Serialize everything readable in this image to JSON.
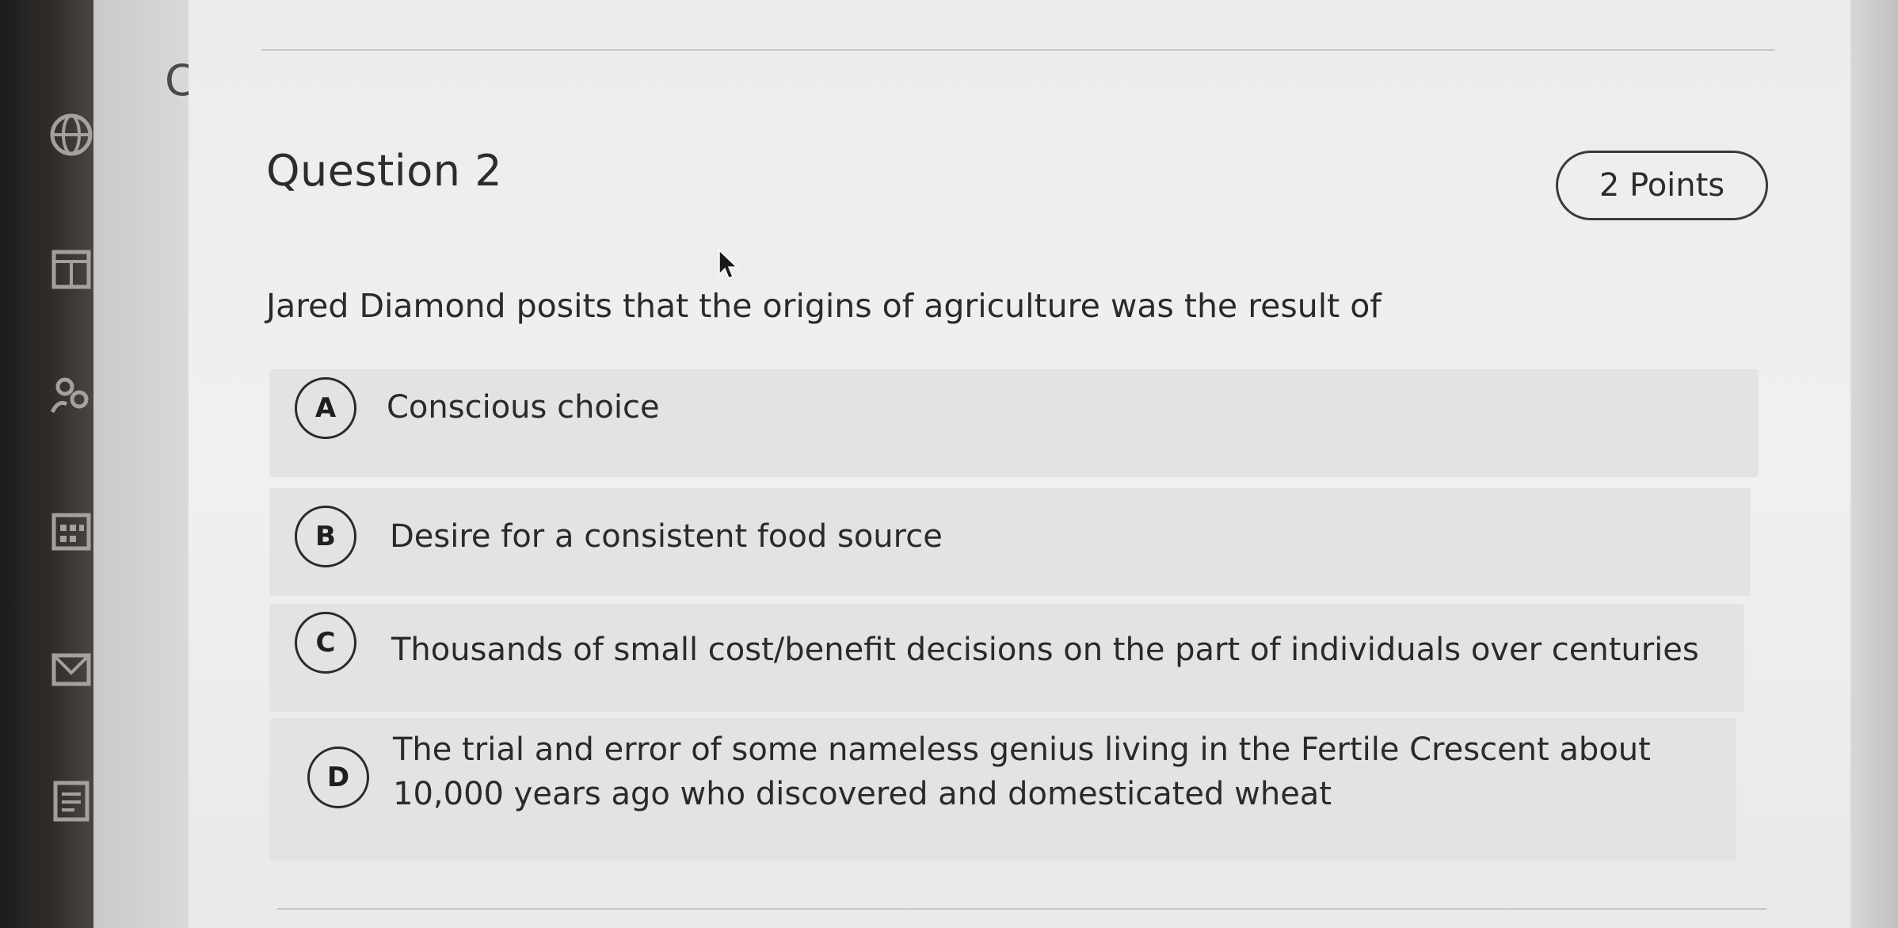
{
  "sidebar": {
    "letter": "C",
    "icons": [
      "globe-icon",
      "columns-icon",
      "people-icon",
      "calendar-icon",
      "mail-icon",
      "document-icon"
    ]
  },
  "question": {
    "title": "Question 2",
    "points": "2 Points",
    "prompt": "Jared Diamond posits that the origins of agriculture was the result of",
    "options": [
      {
        "letter": "A",
        "text": "Conscious choice"
      },
      {
        "letter": "B",
        "text": "Desire for a consistent food source"
      },
      {
        "letter": "C",
        "text": "Thousands of small cost/benefit decisions on the part of individuals over centuries"
      },
      {
        "letter": "D",
        "text_line1": "The trial and error of some nameless genius living in the Fertile Crescent about",
        "text_line2": "10,000 years ago who discovered and domesticated wheat"
      }
    ]
  }
}
